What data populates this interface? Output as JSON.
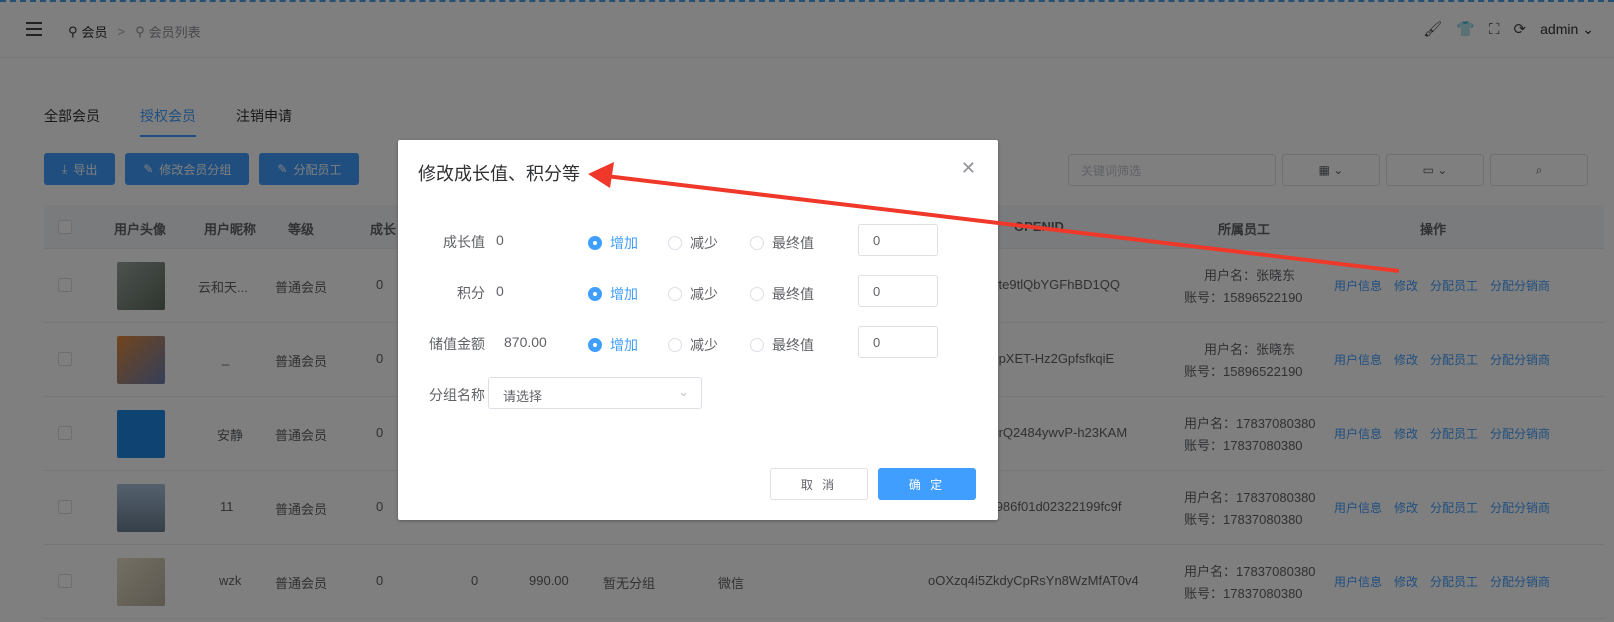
{
  "header": {
    "breadcrumb": [
      "会员",
      "会员列表"
    ],
    "admin": "admin"
  },
  "tabs": [
    "全部会员",
    "授权会员",
    "注销申请"
  ],
  "active_tab": 1,
  "toolbar": {
    "export": "导出",
    "change_group": "修改会员分组",
    "assign_staff": "分配员工"
  },
  "filters": {
    "keyword_placeholder": "关键词筛选"
  },
  "table": {
    "columns": [
      "用户头像",
      "用户昵称",
      "等级",
      "成长",
      "OPENID",
      "所属员工",
      "操作"
    ],
    "rows": [
      {
        "nickname": "云和天...",
        "level": "普通会员",
        "growth": "0",
        "openid": "vzerte9tlQbYGFhBD1QQ",
        "staff_name": "用户名：张晓东",
        "staff_account": "账号：15896522190"
      },
      {
        "nickname": "_",
        "level": "普通会员",
        "growth": "0",
        "openid": "9aQpXET-Hz2GpfsfkqiE",
        "staff_name": "用户名：张晓东",
        "staff_account": "账号：15896522190"
      },
      {
        "nickname": "安静",
        "level": "普通会员",
        "growth": "0",
        "openid": "PX4rQ2484ywvP-h23KAM",
        "staff_name": "用户名：17837080380",
        "staff_account": "账号：17837080380"
      },
      {
        "nickname": "11",
        "level": "普通会员",
        "growth": "0",
        "openid": "920986f01d02322199fc9f",
        "staff_name": "用户名：17837080380",
        "staff_account": "账号：17837080380"
      },
      {
        "nickname": "wzk",
        "level": "普通会员",
        "growth": "0",
        "points": "0",
        "amount": "990.00",
        "group": "暂无分组",
        "source": "微信",
        "openid": "oOXzq4i5ZkdyCpRsYn8WzMfAT0v4",
        "staff_name": "用户名：17837080380",
        "staff_account": "账号：17837080380"
      }
    ],
    "ops": [
      "用户信息",
      "修改",
      "分配员工",
      "分配分销商"
    ]
  },
  "dialog": {
    "title": "修改成长值、积分等",
    "fields": [
      {
        "label": "成长值",
        "value": "0",
        "input": "0"
      },
      {
        "label": "积分",
        "value": "0",
        "input": "0"
      },
      {
        "label": "储值金额",
        "value": "870.00",
        "input": "0"
      }
    ],
    "radio_options": [
      "增加",
      "减少",
      "最终值"
    ],
    "group_label": "分组名称",
    "group_placeholder": "请选择",
    "cancel": "取 消",
    "confirm": "确 定"
  },
  "colors": {
    "primary": "#409eff",
    "arrow": "#f0382a"
  }
}
